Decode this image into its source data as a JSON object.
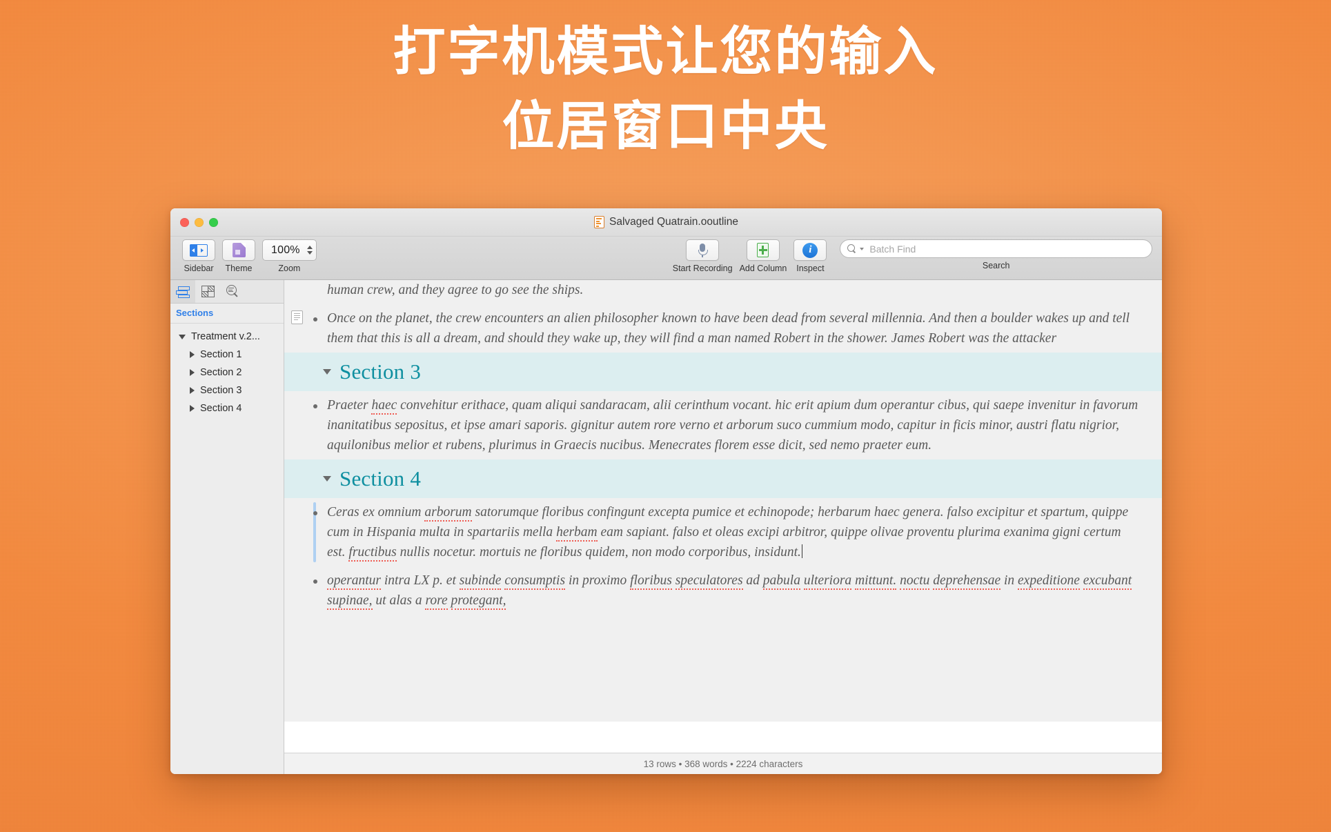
{
  "headline": {
    "line1": "打字机模式让您的输入",
    "line2": "位居窗口中央"
  },
  "window": {
    "title": "Salvaged Quatrain.ooutline",
    "doc_icon": "outline-document-icon"
  },
  "toolbar": {
    "sidebar_label": "Sidebar",
    "theme_label": "Theme",
    "zoom_label": "Zoom",
    "zoom_value": "100%",
    "start_recording_label": "Start Recording",
    "add_column_label": "Add Column",
    "inspect_label": "Inspect",
    "search_label": "Search",
    "search_placeholder": "Batch Find",
    "search_value": ""
  },
  "sidebar": {
    "tabs": [
      {
        "name": "sections-tab",
        "icon": "sections-icon",
        "active": true
      },
      {
        "name": "styles-tab",
        "icon": "checkerboard-icon",
        "active": false
      },
      {
        "name": "find-tab",
        "icon": "find-magnifier-icon",
        "active": false
      }
    ],
    "header": "Sections",
    "items": [
      {
        "label": "Treatment v.2...",
        "level": 0,
        "expanded": true
      },
      {
        "label": "Section 1",
        "level": 1,
        "expanded": false
      },
      {
        "label": "Section 2",
        "level": 1,
        "expanded": false
      },
      {
        "label": "Section 3",
        "level": 1,
        "expanded": false
      },
      {
        "label": "Section 4",
        "level": 1,
        "expanded": false
      }
    ]
  },
  "document": {
    "clipped_line": "human crew, and they agree to go see the ships.",
    "bullet_top": "Once on the planet, the crew encounters an alien philosopher known to have been dead from several millennia. And then a boulder wakes up and tell them that this is all a dream, and should they wake up, they will find a man named Robert in the shower. James Robert was the attacker",
    "section3_title": "Section 3",
    "section3_bullet": "Praeter haec convehitur erithace, quam aliqui sandaracam, alii cerinthum vocant. hic erit apium dum operantur cibus, qui saepe invenitur in favorum inanitatibus sepositus, et ipse amari saporis. gignitur autem rore verno et arborum suco cummium modo, capitur in ficis minor, austri flatu nigrior, aquilonibus melior et rubens, plurimus in Graecis nucibus. Menecrates florem esse dicit, sed nemo praeter eum.",
    "section4_title": "Section 4",
    "section4_bullet1": "Ceras ex omnium arborum satorumque floribus confingunt excepta pumice et echinopode; herbarum haec genera. falso excipitur et spartum, quippe cum in Hispania multa in spartariis mella herbam eam sapiant. falso et oleas excipi arbitror, quippe olivae proventu plurima exanima gigni certum est. fructibus nullis nocetur. mortuis ne floribus quidem, non modo corporibus, insidunt.",
    "section4_bullet2": "operantur intra LX p. et subinde consumptis in proximo floribus speculatores ad pabula ulteriora mittunt. noctu deprehensae in expeditione excubant supinae, ut alas a rore protegant,",
    "misspelled_words": [
      "haec",
      "arborum",
      "herbam",
      "fructibus",
      "operantur",
      "subinde",
      "consumptis",
      "floribus",
      "speculatores",
      "pabula",
      "ulteriora",
      "mittunt",
      "noctu",
      "deprehensae",
      "expeditione",
      "excubant",
      "supinae",
      "rore",
      "protegant"
    ]
  },
  "status": {
    "text": "13 rows • 368 words • 2224 characters",
    "rows": "13 rows",
    "words": "368 words",
    "characters": "2224 characters"
  },
  "colors": {
    "backdrop": "#F4893D",
    "section_band": "#DCEEF0",
    "section_title": "#0E8FA0",
    "accent_blue": "#2F7FE8",
    "focus_bar": "#AFD0F2",
    "spellcheck": "#EE5B52"
  }
}
